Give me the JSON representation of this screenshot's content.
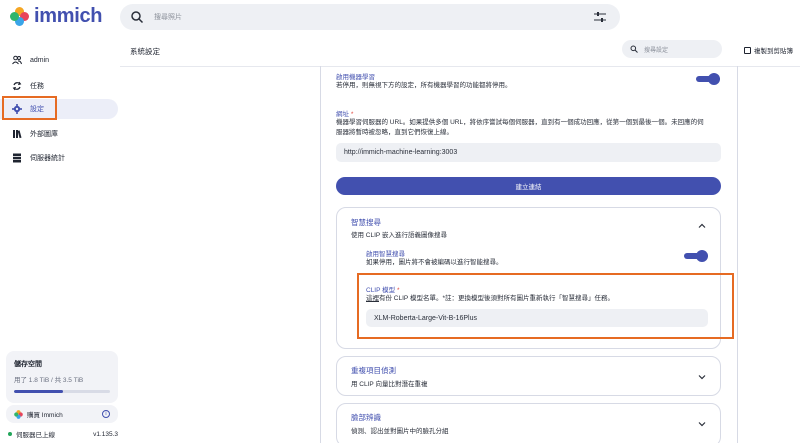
{
  "app": {
    "name": "immich"
  },
  "topbar": {
    "search_placeholder": "搜尋照片"
  },
  "sidebar": {
    "items": [
      {
        "label": "admin",
        "icon": "users-icon"
      },
      {
        "label": "任務",
        "icon": "sync-icon"
      },
      {
        "label": "設定",
        "icon": "gear-icon",
        "active": true
      },
      {
        "label": "外部圖庫",
        "icon": "library-icon"
      },
      {
        "label": "伺服器統計",
        "icon": "server-icon"
      }
    ],
    "storage": {
      "title": "儲存空間",
      "usage": "用了 1.8 TiB / 共 3.5 TiB",
      "fraction": 0.51
    },
    "buy": {
      "label": "購買 Immich"
    },
    "server": {
      "status": "伺服器已上線",
      "version": "v1.135.3"
    }
  },
  "page": {
    "title": "系統設定",
    "settings_search_placeholder": "搜尋設定",
    "copy_label": "複製到剪貼簿"
  },
  "ml": {
    "enable_label": "啟用機器學習",
    "enable_desc": "若停用，則無視下方的設定，所有機器學習的功能都將停用。",
    "url_label": "網址",
    "url_desc_1": "機器學習伺服器的 URL。如果提供多個 URL，將依序嘗試每個伺服器，直到有一個成功回應，從第一個到最後一個。未回應的伺",
    "url_desc_2": "服器將暫時被忽略，直到它們恢復上線。",
    "url_value": "http://immich-machine-learning:3003",
    "add_link_button": "建立連結"
  },
  "smart_search": {
    "title": "智慧搜尋",
    "subtitle": "使用 CLIP 嵌入進行語義圖像搜尋",
    "enable_label": "啟用智慧搜尋",
    "enable_desc": "如果停用，圖片將不會被編碼以進行智能搜尋。",
    "clip_label": "CLIP 模型",
    "clip_desc_link": "這裡",
    "clip_desc_rest": "有份 CLIP 模型名單。*註：更換模型後須對所有圖片重新執行「智慧搜尋」任務。",
    "clip_value": "XLM-Roberta-Large-Vit-B-16Plus"
  },
  "duplicate": {
    "title": "重複項目偵測",
    "subtitle": "用 CLIP 向量比對潛在重複"
  },
  "face": {
    "title": "臉部辨識",
    "subtitle": "偵測、認出並對圖片中的臉孔分組"
  },
  "colors": {
    "accent": "#4250af",
    "highlight": "#e66b23"
  }
}
